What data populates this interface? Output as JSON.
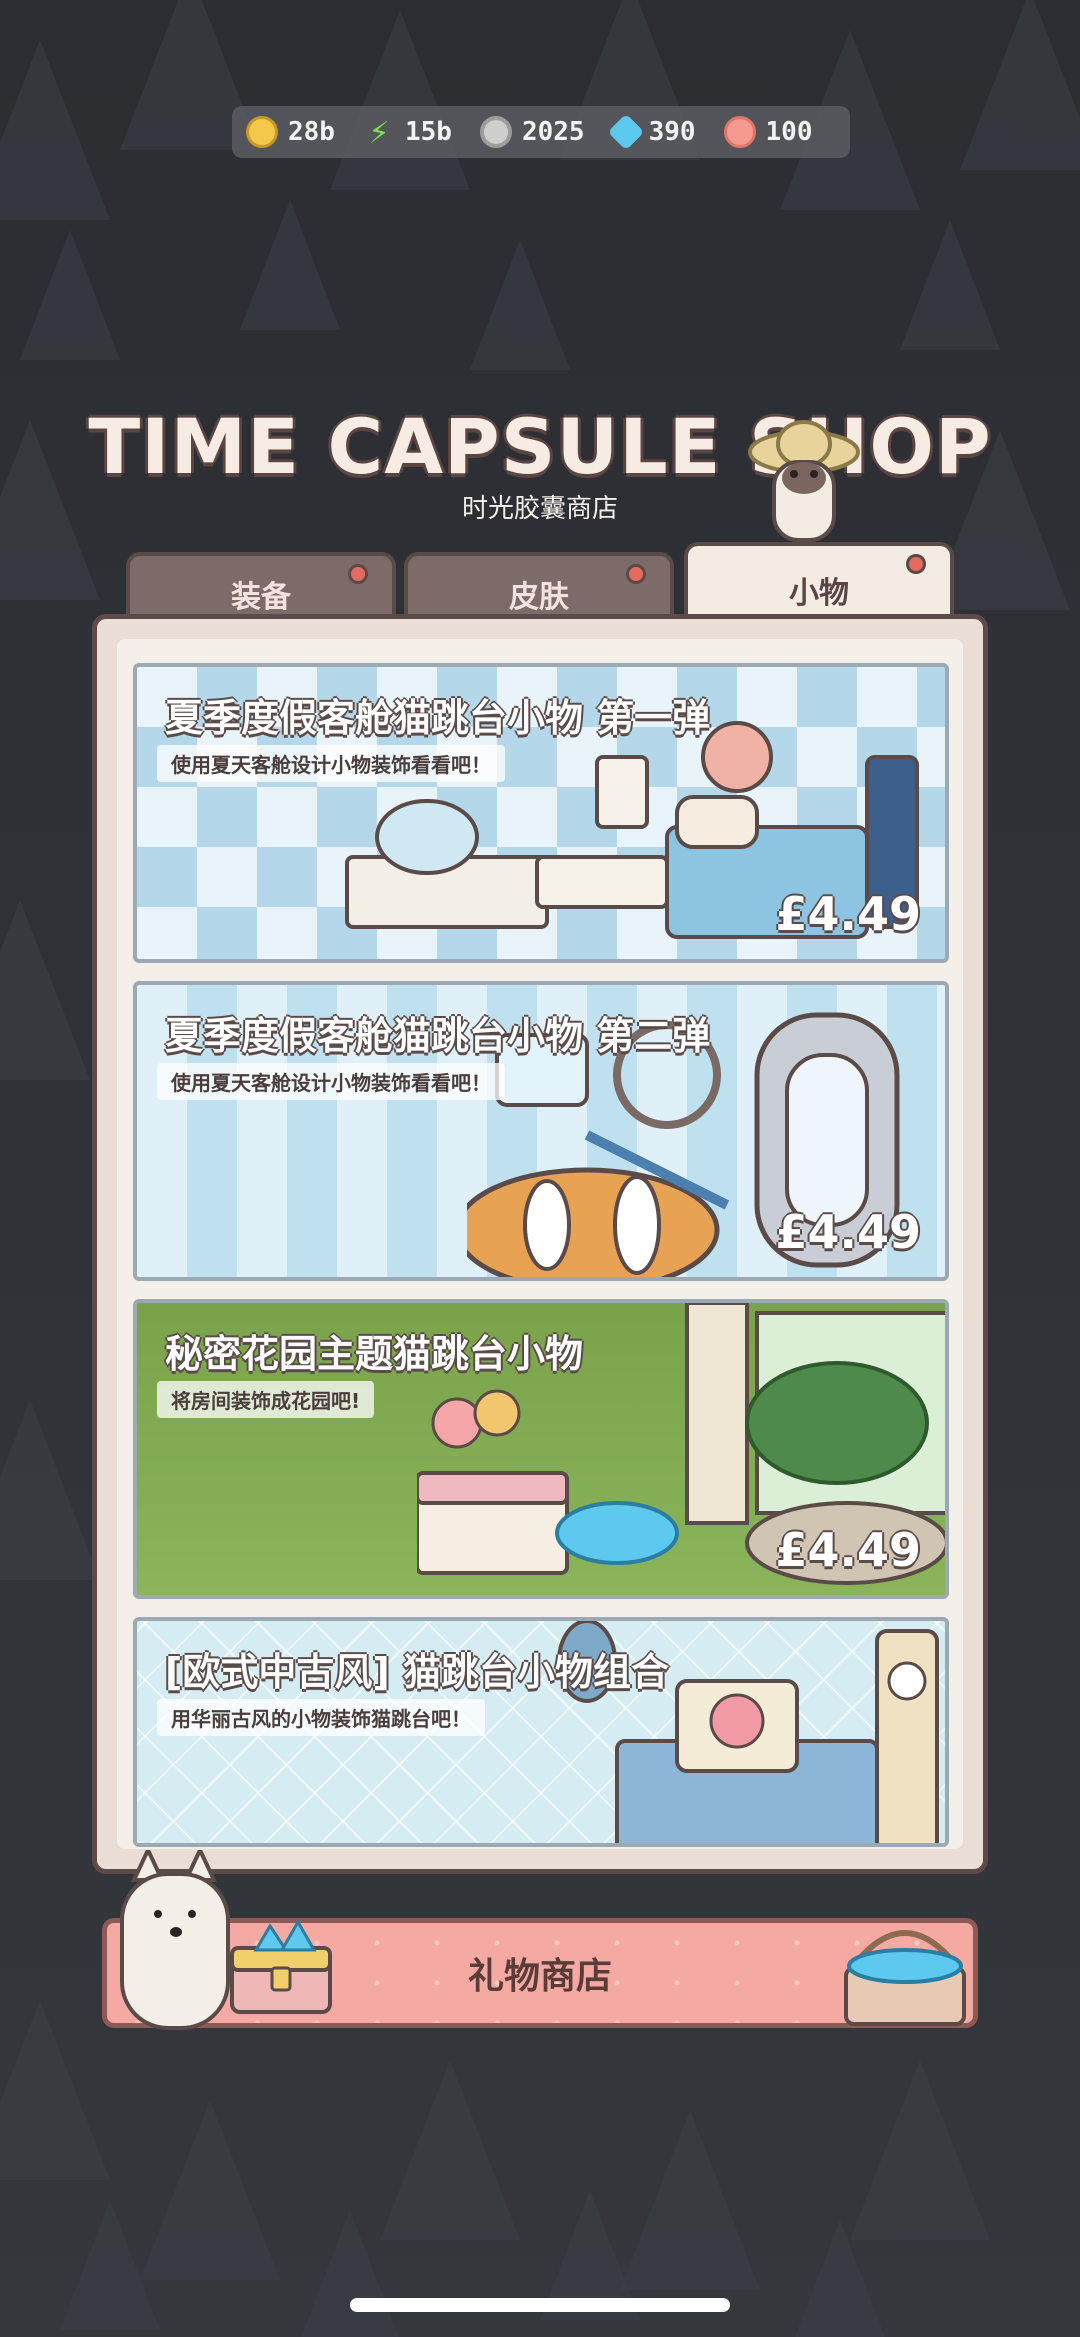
{
  "currencies": [
    {
      "icon": "coin-icon",
      "value": "28b"
    },
    {
      "icon": "energy-icon",
      "value": "15b"
    },
    {
      "icon": "nut-icon",
      "value": "2025"
    },
    {
      "icon": "gem-icon",
      "value": "390"
    },
    {
      "icon": "paw-icon",
      "value": "100"
    }
  ],
  "header": {
    "title": "TIME CAPSULE SHOP",
    "subtitle": "时光胶囊商店"
  },
  "tabs": [
    {
      "label": "装备",
      "active": false,
      "has_badge": true
    },
    {
      "label": "皮肤",
      "active": false,
      "has_badge": true
    },
    {
      "label": "小物",
      "active": true,
      "has_badge": true
    }
  ],
  "items": [
    {
      "title": "夏季度假客舱猫跳台小物 第一弹",
      "subtitle": "使用夏天客舱设计小物装饰看看吧！",
      "price": "£4.49"
    },
    {
      "title": "夏季度假客舱猫跳台小物 第二弹",
      "subtitle": "使用夏天客舱设计小物装饰看看吧！",
      "price": "£4.49"
    },
    {
      "title": "秘密花园主题猫跳台小物",
      "subtitle": "将房间装饰成花园吧!",
      "price": "£4.49"
    },
    {
      "title": "[欧式中古风] 猫跳台小物组合",
      "subtitle": "用华丽古风的小物装饰猫跳台吧！",
      "price": ""
    }
  ],
  "gift_shop": {
    "label": "礼物商店"
  },
  "colors": {
    "background": "#2f3136",
    "panel": "#e9ddd6",
    "tab_inactive": "#7c6b68",
    "tab_active": "#f3ece3",
    "gift_button": "#f4aaa2",
    "badge": "#e56a60"
  }
}
